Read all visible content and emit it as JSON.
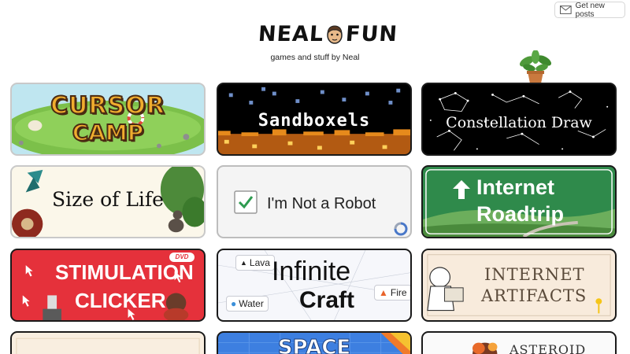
{
  "header": {
    "logo_left": "NEAL",
    "logo_right": "FUN",
    "tagline": "games and stuff by Neal",
    "subscribe_label": "Get new posts",
    "icons": {
      "subscribe": "envelope-icon",
      "logo": "neal-face-icon",
      "decor": "potted-plant-icon"
    }
  },
  "cards": [
    {
      "title_lines": [
        "CURSOR",
        "CAMP"
      ],
      "colors": {
        "bg": "#bfe6f0",
        "text": "#f0ad2e"
      }
    },
    {
      "title": "Sandboxels",
      "colors": {
        "bg": "#000000",
        "text": "#ffffff"
      }
    },
    {
      "title": "Constellation Draw",
      "colors": {
        "bg": "#000000",
        "text": "#ffffff"
      }
    },
    {
      "title": "Size of Life",
      "colors": {
        "bg": "#fbf7ea",
        "text": "#111111"
      }
    },
    {
      "title": "I'm Not a Robot",
      "colors": {
        "bg": "#f4f4f4",
        "check": "#2e9b50"
      }
    },
    {
      "title_lines": [
        "Internet",
        "Roadtrip"
      ],
      "colors": {
        "bg": "#2f8a4b",
        "text": "#ffffff"
      }
    },
    {
      "title_lines": [
        "STIMULATION",
        "CLICKER"
      ],
      "badge": "DVD",
      "colors": {
        "bg": "#e5313b",
        "text": "#ffffff"
      }
    },
    {
      "title_lines": [
        "Infinite",
        "Craft"
      ],
      "elements": [
        "Lava",
        "Water",
        "Fire"
      ],
      "colors": {
        "bg": "#f6f7fb"
      }
    },
    {
      "title_lines": [
        "INTERNET",
        "ARTIFACTS"
      ],
      "colors": {
        "bg": "#f8ebdc",
        "text": "#5a4a3a"
      }
    },
    {
      "title": "",
      "colors": {
        "bg": "#f9eee0"
      }
    },
    {
      "title": "SPACE",
      "colors": {
        "bg": "#3d7fe0"
      }
    },
    {
      "title": "ASTEROID",
      "colors": {
        "bg": "#fafafa"
      }
    }
  ]
}
